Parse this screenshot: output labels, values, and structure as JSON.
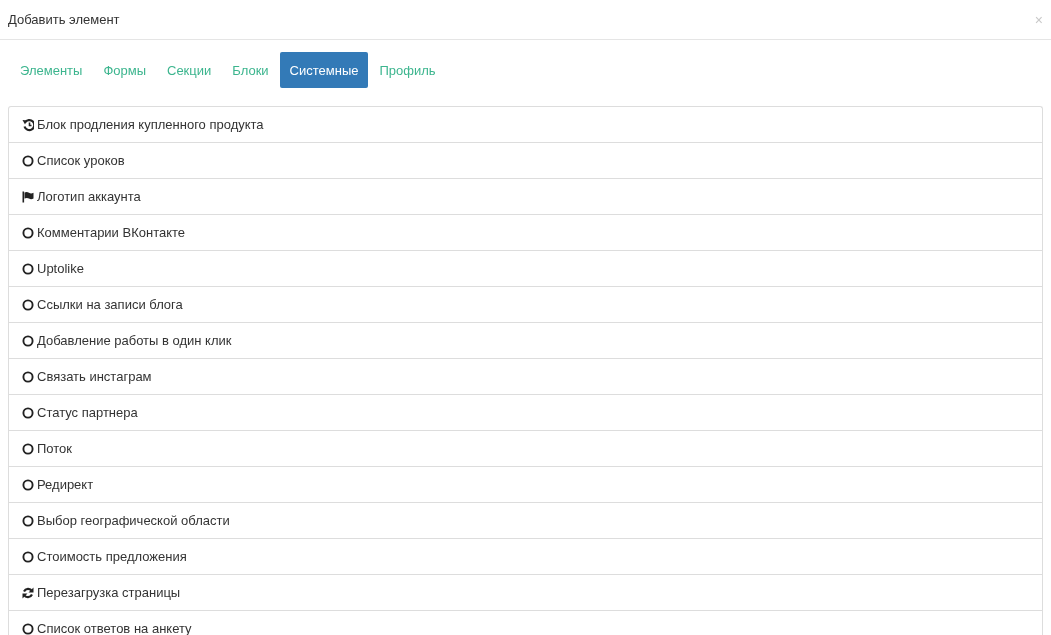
{
  "dialog": {
    "title": "Добавить элемент",
    "close": "×"
  },
  "tabs": [
    {
      "label": "Элементы",
      "selected": false
    },
    {
      "label": "Формы",
      "selected": false
    },
    {
      "label": "Секции",
      "selected": false
    },
    {
      "label": "Блоки",
      "selected": false
    },
    {
      "label": "Системные",
      "selected": true
    },
    {
      "label": "Профиль",
      "selected": false
    }
  ],
  "items": [
    {
      "kind": "history",
      "label": "Блок продления купленного продукта"
    },
    {
      "kind": "circle",
      "label": "Список уроков"
    },
    {
      "kind": "flag",
      "label": "Логотип аккаунта"
    },
    {
      "kind": "circle",
      "label": "Комментарии ВКонтакте"
    },
    {
      "kind": "circle",
      "label": "Uptolike"
    },
    {
      "kind": "circle",
      "label": "Ссылки на записи блога"
    },
    {
      "kind": "circle",
      "label": "Добавление работы в один клик"
    },
    {
      "kind": "circle",
      "label": "Связать инстаграм"
    },
    {
      "kind": "circle",
      "label": "Статус партнера"
    },
    {
      "kind": "circle",
      "label": "Поток"
    },
    {
      "kind": "circle",
      "label": "Редирект"
    },
    {
      "kind": "circle",
      "label": "Выбор географической области"
    },
    {
      "kind": "circle",
      "label": "Стоимость предложения"
    },
    {
      "kind": "refresh",
      "label": "Перезагрузка страницы"
    },
    {
      "kind": "circle",
      "label": "Список ответов на анкету"
    }
  ]
}
